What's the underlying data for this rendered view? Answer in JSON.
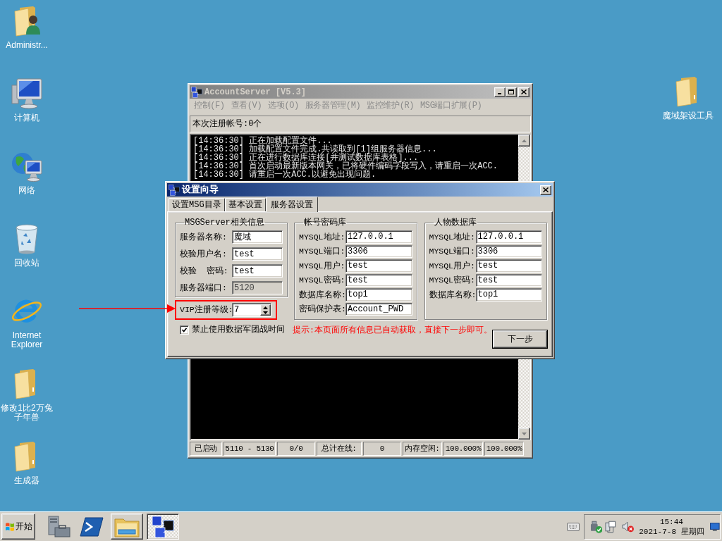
{
  "desktop": {
    "icons": [
      {
        "kind": "user-folder",
        "label": "Administr..."
      },
      {
        "kind": "computer",
        "label": "计算机"
      },
      {
        "kind": "network",
        "label": "网络"
      },
      {
        "kind": "recycle-bin",
        "label": "回收站"
      },
      {
        "kind": "browser",
        "label": "Internet Explorer"
      },
      {
        "kind": "folder",
        "label": "修改1比2万兔子年兽"
      },
      {
        "kind": "folder",
        "label": "生成器"
      },
      {
        "kind": "folder",
        "label": "魔域架设工具"
      }
    ]
  },
  "main_window": {
    "title": "AccountServer [V5.3]",
    "active": false,
    "menu": [
      {
        "label": "控制(F)",
        "disabled": true
      },
      {
        "label": "查看(V)",
        "disabled": true
      },
      {
        "label": "选项(O)",
        "disabled": true
      },
      {
        "label": "服务器管理(M)",
        "disabled": true
      },
      {
        "label": "监控维护(R)",
        "disabled": true
      },
      {
        "label": "MSG端口扩展(P)",
        "disabled": true
      }
    ],
    "registered_count": "本次注册帐号:0个",
    "log": [
      "[14:36:30] 正在加载配置文件...",
      "[14:36:30] 加载配置文件完成.共读取到[1]组服务器信息...",
      "[14:36:30] 正在进行数据库连接[并测试数据库表格]...",
      "[14:36:30] 首次启动最新版本网关，已将硬件编码字段写入，请重启一次ACC.",
      "[14:36:30] 请重启一次ACC.以避免出现问题."
    ],
    "status_bar": [
      "已启动",
      "5110 - 5130",
      "0/0",
      "总计在线:",
      "0",
      "内存空闲:",
      "100.000%",
      "100.000%"
    ]
  },
  "dialog": {
    "title": "设置向导",
    "active": true,
    "tabs": [
      {
        "label": "设置MSG目录",
        "selected": false
      },
      {
        "label": "基本设置",
        "selected": false
      },
      {
        "label": "服务器设置",
        "selected": true
      }
    ],
    "groups": [
      {
        "title": "MSGServer相关信息",
        "fields": [
          {
            "label": "服务器名称:",
            "value": "魔域",
            "disabled": false
          },
          {
            "label": "校验用户名:",
            "value": "test",
            "disabled": false
          },
          {
            "label": "校验  密码:",
            "value": "test",
            "disabled": false
          },
          {
            "label": "服务器端口:",
            "value": "5120",
            "disabled": true
          }
        ]
      },
      {
        "title": "帐号密码库",
        "fields": [
          {
            "label": "MYSQL地址:",
            "value": "127.0.0.1",
            "disabled": false
          },
          {
            "label": "MYSQL端口:",
            "value": "3306",
            "disabled": false
          },
          {
            "label": "MYSQL用户:",
            "value": "test",
            "disabled": false
          },
          {
            "label": "MYSQL密码:",
            "value": "test",
            "disabled": false
          },
          {
            "label": "数据库名称:",
            "value": "top1",
            "disabled": false
          },
          {
            "label": "密码保护表:",
            "value": "Account_PWD",
            "disabled": false
          }
        ]
      },
      {
        "title": "人物数据库",
        "fields": [
          {
            "label": "MYSQL地址:",
            "value": "127.0.0.1",
            "disabled": false
          },
          {
            "label": "MYSQL端口:",
            "value": "3306",
            "disabled": false
          },
          {
            "label": "MYSQL用户:",
            "value": "test",
            "disabled": false
          },
          {
            "label": "MYSQL密码:",
            "value": "test",
            "disabled": false
          },
          {
            "label": "数据库名称:",
            "value": "top1",
            "disabled": false
          }
        ]
      }
    ],
    "vip_level": {
      "label": "VIP注册等级:",
      "value": "7"
    },
    "guild_war_option": {
      "label": "禁止使用数据军团战时间",
      "checked": true
    },
    "hint": "提示:本页面所有信息已自动获取，直接下一步即可。",
    "next_button": "下一步"
  },
  "taskbar": {
    "start_button": "开始",
    "quick_launch": [
      {
        "kind": "server-manager"
      },
      {
        "kind": "powershell"
      }
    ],
    "buttons": [
      {
        "kind": "explorer",
        "selected": false
      },
      {
        "kind": "app",
        "selected": true
      }
    ],
    "clock": {
      "time": "15:44",
      "date": "2021-7-8 星期四"
    }
  }
}
